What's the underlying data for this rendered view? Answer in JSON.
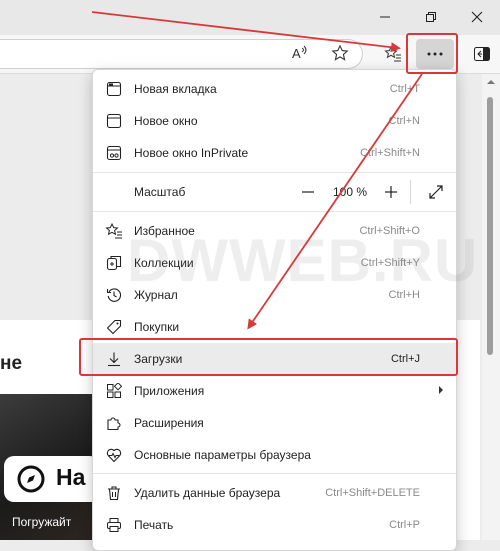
{
  "colors": {
    "highlight": "#d9383a",
    "menu_bg": "#ffffff",
    "hover_row": "#ebebeb"
  },
  "menu": {
    "items": [
      {
        "label": "Новая вкладка",
        "shortcut": "Ctrl+T",
        "icon": "new-tab-icon"
      },
      {
        "label": "Новое окно",
        "shortcut": "Ctrl+N",
        "icon": "new-window-icon"
      },
      {
        "label": "Новое окно InPrivate",
        "shortcut": "Ctrl+Shift+N",
        "icon": "inprivate-icon"
      },
      {
        "label": "Масштаб",
        "icon": "zoom-icon"
      },
      {
        "label": "Избранное",
        "shortcut": "Ctrl+Shift+O",
        "icon": "favorites-icon"
      },
      {
        "label": "Коллекции",
        "shortcut": "Ctrl+Shift+Y",
        "icon": "collections-icon"
      },
      {
        "label": "Журнал",
        "shortcut": "Ctrl+H",
        "icon": "history-icon"
      },
      {
        "label": "Покупки",
        "shortcut": "",
        "icon": "shopping-tag-icon"
      },
      {
        "label": "Загрузки",
        "shortcut": "Ctrl+J",
        "icon": "downloads-icon"
      },
      {
        "label": "Приложения",
        "shortcut": "",
        "icon": "apps-icon"
      },
      {
        "label": "Расширения",
        "shortcut": "",
        "icon": "extensions-icon"
      },
      {
        "label": "Основные параметры браузера",
        "shortcut": "",
        "icon": "browser-essentials-icon"
      },
      {
        "label": "Удалить данные браузера",
        "shortcut": "Ctrl+Shift+DELETE",
        "icon": "trash-icon"
      },
      {
        "label": "Печать",
        "shortcut": "Ctrl+P",
        "icon": "print-icon"
      }
    ],
    "zoom": {
      "value": "100 %",
      "minus": "—",
      "plus": "+"
    }
  },
  "page": {
    "heading_fragment": "не",
    "search_fragment": "На",
    "promo_fragment": "Погружайт"
  },
  "watermark": "DWWEB.RU"
}
